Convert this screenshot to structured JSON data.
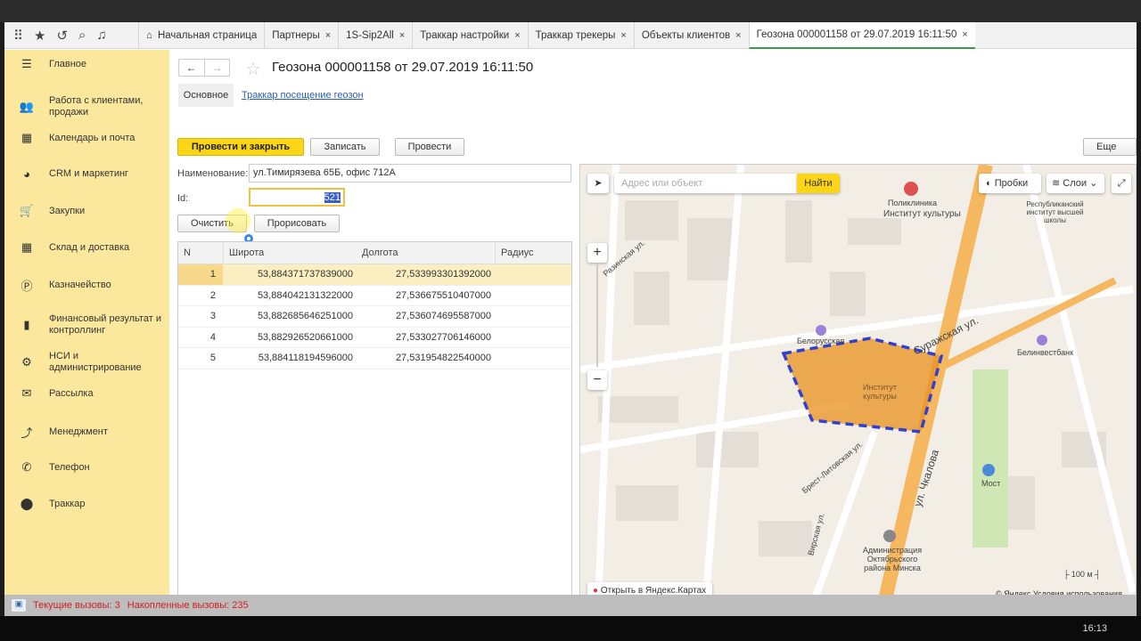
{
  "tabs": [
    {
      "label": "Начальная страница",
      "closable": false
    },
    {
      "label": "Партнеры",
      "closable": true
    },
    {
      "label": "1S-Sip2All",
      "closable": true
    },
    {
      "label": "Траккар настройки",
      "closable": true
    },
    {
      "label": "Траккар трекеры",
      "closable": true
    },
    {
      "label": "Объекты клиентов",
      "closable": true
    },
    {
      "label": "Геозона 000001158 от 29.07.2019 16:11:50",
      "closable": true,
      "active": true
    }
  ],
  "close_glyph": "×",
  "sidebar": {
    "items": [
      {
        "label": "Главное",
        "icon": "☰"
      },
      {
        "label": "Работа с клиентами, продажи",
        "icon": "👥"
      },
      {
        "label": "Календарь и почта",
        "icon": "▦"
      },
      {
        "label": "CRM и маркетинг",
        "icon": "◕"
      },
      {
        "label": "Закупки",
        "icon": "🛒"
      },
      {
        "label": "Склад и доставка",
        "icon": "▦"
      },
      {
        "label": "Казначейство",
        "icon": "Ⓟ"
      },
      {
        "label": "Финансовый результат и контроллинг",
        "icon": "▮"
      },
      {
        "label": "НСИ и администрирование",
        "icon": "⚙"
      },
      {
        "label": "Рассылка",
        "icon": "✉"
      },
      {
        "label": "Менеджмент",
        "icon": "⤴"
      },
      {
        "label": "Телефон",
        "icon": "✆"
      },
      {
        "label": "Траккар",
        "icon": "⬤"
      }
    ]
  },
  "form": {
    "title": "Геозона 000001158 от 29.07.2019 16:11:50",
    "subtabs": [
      "Основное",
      "Траккар посещение геозон"
    ],
    "buttons": {
      "post_close": "Провести и закрыть",
      "save": "Записать",
      "post": "Провести",
      "more": "Еще",
      "clear": "Очистить",
      "draw": "Прорисовать"
    },
    "name_label": "Наименование:",
    "name_value": "ул.Тимирязева 65Б, офис 712А",
    "id_label": "Id:",
    "id_value": "521"
  },
  "table": {
    "columns": [
      "N",
      "Широта",
      "Долгота",
      "Радиус"
    ],
    "rows": [
      {
        "n": "1",
        "lat": "53,884371737839000",
        "lon": "27,533993301392000",
        "radius": ""
      },
      {
        "n": "2",
        "lat": "53,884042131322000",
        "lon": "27,536675510407000",
        "radius": ""
      },
      {
        "n": "3",
        "lat": "53,882685646251000",
        "lon": "27,536074695587000",
        "radius": ""
      },
      {
        "n": "4",
        "lat": "53,882926520661000",
        "lon": "27,533027706146000",
        "radius": ""
      },
      {
        "n": "5",
        "lat": "53,884118194596000",
        "lon": "27,531954822540000",
        "radius": ""
      }
    ]
  },
  "map": {
    "search_placeholder": "Адрес или объект",
    "search_button": "Найти",
    "traffic": "Пробки",
    "layers": "Слои",
    "zoom_in": "+",
    "zoom_out": "−",
    "open_link": "Открыть в Яндекс.Картах",
    "copyright": "© Яндекс",
    "terms": "Условия использования",
    "scale": "100 м",
    "labels": [
      {
        "text": "Поликлиника"
      },
      {
        "text": "Институт культуры"
      },
      {
        "text": "Республиканский институт высшей школы"
      },
      {
        "text": "Суражская ул."
      },
      {
        "text": "ул. Чкалова"
      },
      {
        "text": "Белорусская"
      },
      {
        "text": "Институт культуры"
      },
      {
        "text": "Белинвестбанк"
      },
      {
        "text": "Мост"
      },
      {
        "text": "Администрация Октябрьского района Минска"
      },
      {
        "text": "Брест-Литовская ул."
      },
      {
        "text": "Разинская ул."
      },
      {
        "text": "Вирская ул."
      }
    ],
    "polygon_color": "#e8901c"
  },
  "status": {
    "current": "Текущие вызовы: 3",
    "accumulated": "Накопленные вызовы: 235"
  },
  "clock": "16:13"
}
